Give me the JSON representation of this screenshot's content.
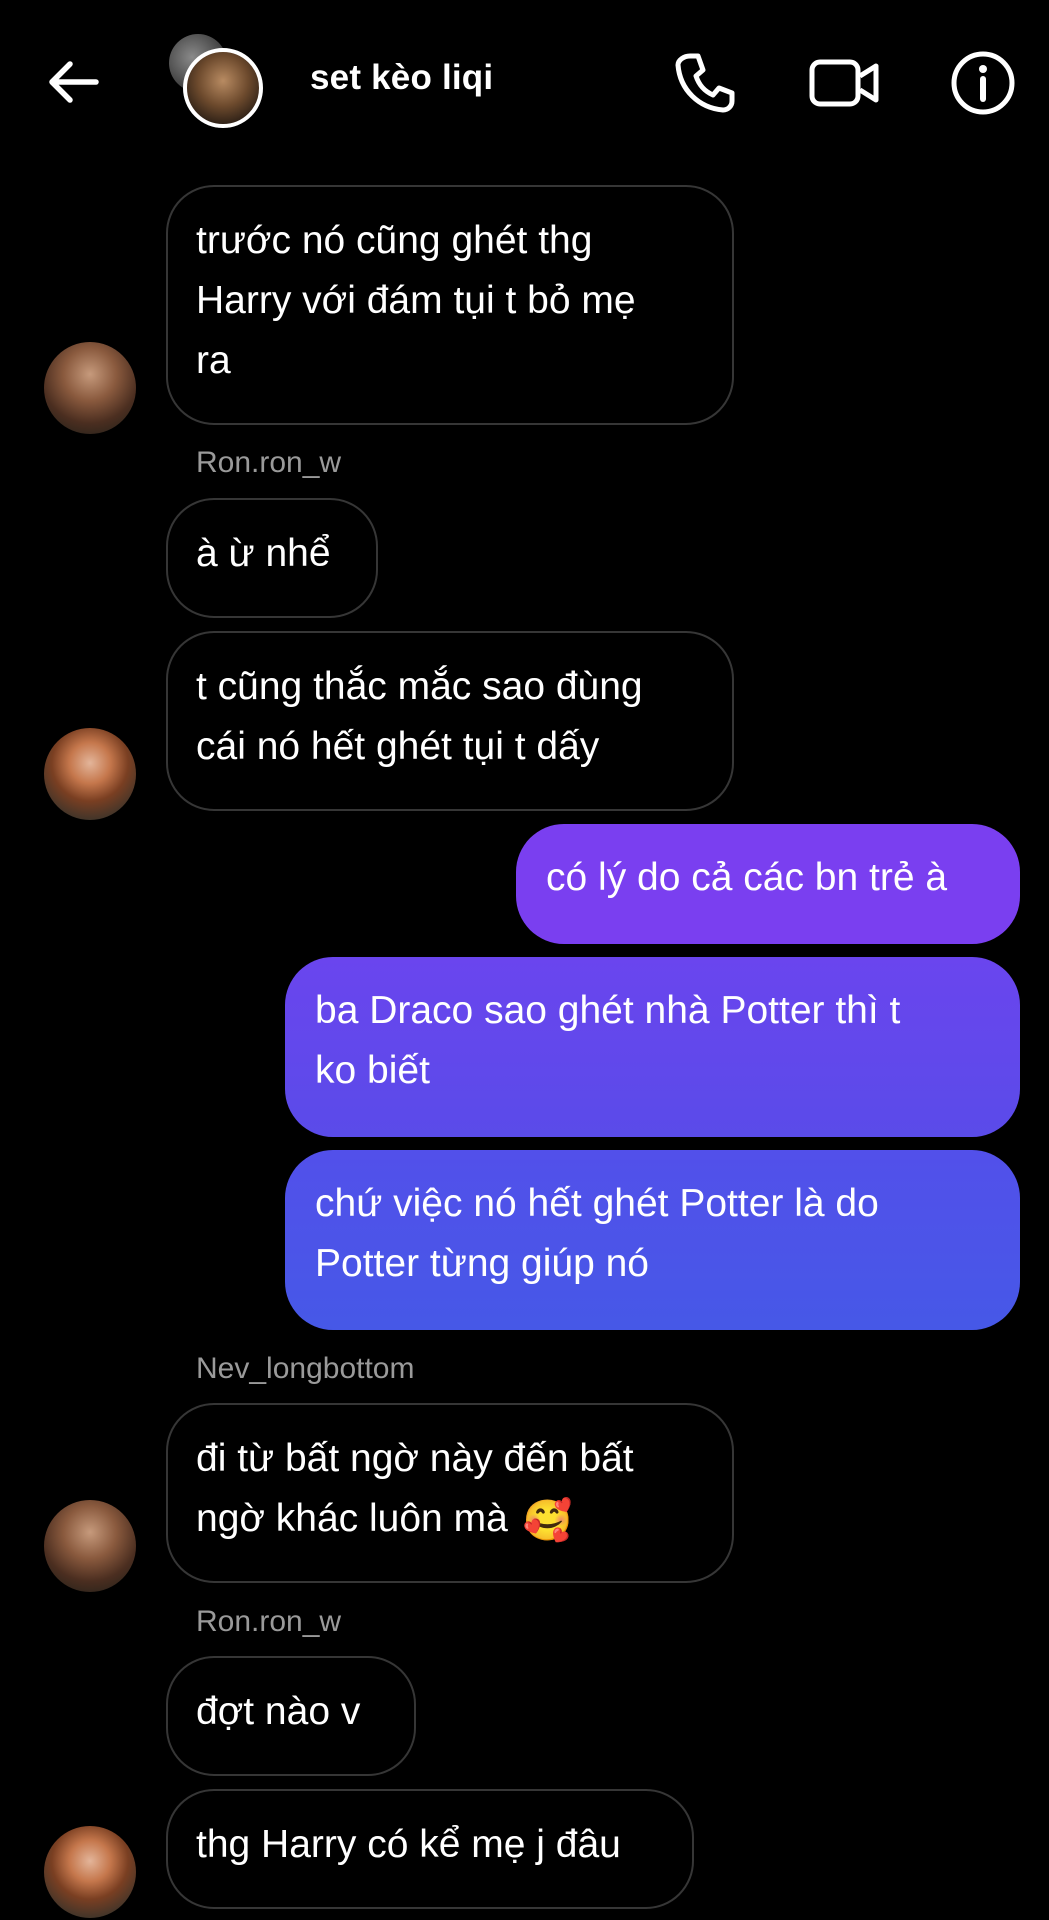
{
  "header": {
    "title": "set kèo liqi",
    "back_icon": "back-arrow-icon",
    "phone_icon": "phone-icon",
    "video_icon": "video-camera-icon",
    "info_icon": "info-icon"
  },
  "colors": {
    "background": "#000000",
    "incoming_border": "#363636",
    "outgoing_top": "#7a3ff0",
    "outgoing_bottom": "#4a55e8",
    "sender_name": "#9a9a9a"
  },
  "messages": [
    {
      "direction": "incoming",
      "lines": [
        "trước nó cũng ghét thg",
        "Harry với đám tụi t bỏ mẹ",
        "ra"
      ]
    },
    {
      "sender": "Ron.ron_w"
    },
    {
      "direction": "incoming",
      "lines": [
        "à ừ nhể"
      ]
    },
    {
      "direction": "incoming",
      "lines": [
        "t cũng thắc mắc sao đùng",
        "cái nó hết ghét tụi t dấy"
      ]
    },
    {
      "direction": "outgoing",
      "lines": [
        "có lý do cả các bn trẻ à"
      ]
    },
    {
      "direction": "outgoing",
      "lines": [
        "ba Draco sao ghét nhà Potter thì t",
        "ko biết"
      ]
    },
    {
      "direction": "outgoing",
      "lines": [
        "chứ việc nó hết ghét Potter là do",
        "Potter từng giúp nó"
      ]
    },
    {
      "sender": "Nev_longbottom"
    },
    {
      "direction": "incoming",
      "lines": [
        "đi từ bất ngờ này đến bất",
        "ngờ khác luôn mà"
      ],
      "emoji": "🥰"
    },
    {
      "sender": "Ron.ron_w"
    },
    {
      "direction": "incoming",
      "lines": [
        "đợt nào v"
      ]
    },
    {
      "direction": "incoming",
      "lines": [
        "thg Harry có kể mẹ j đâu"
      ]
    }
  ]
}
